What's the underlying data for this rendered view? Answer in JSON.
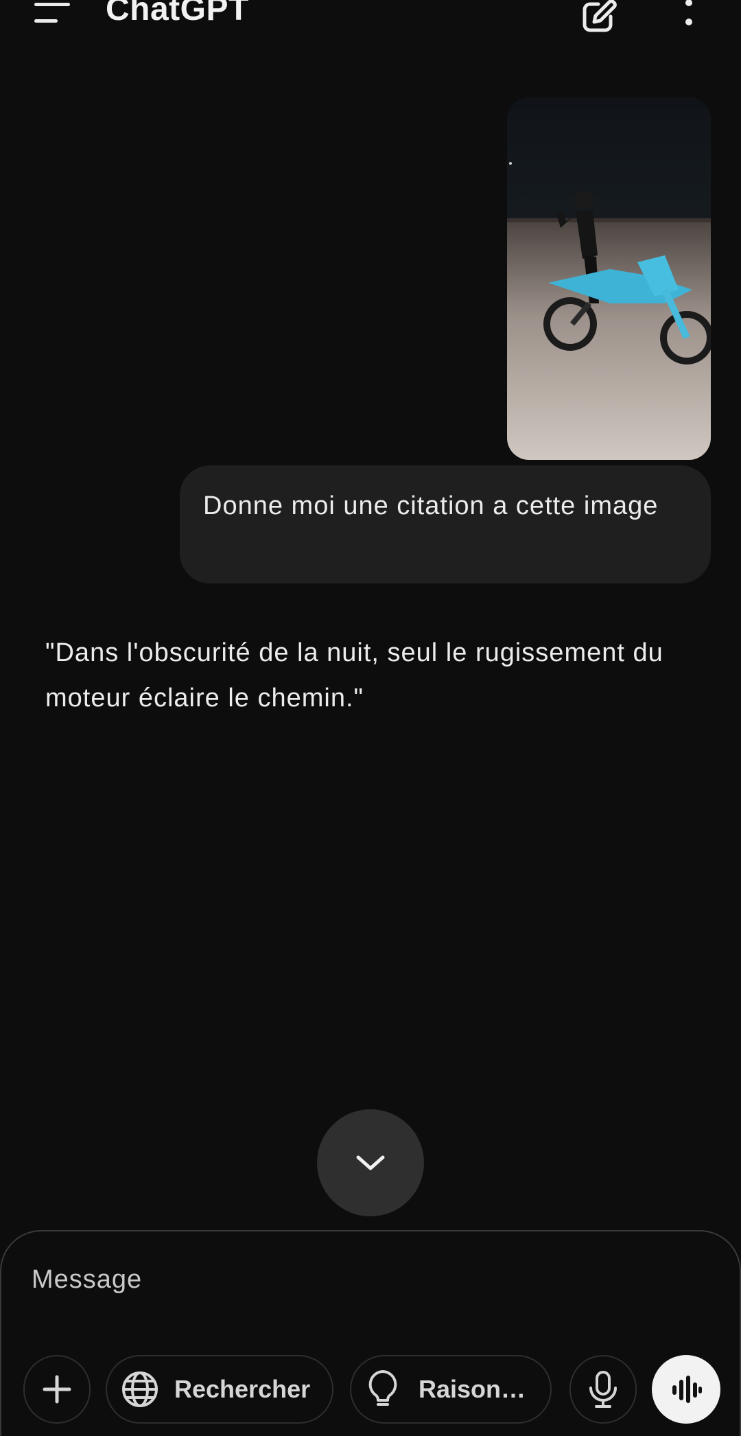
{
  "header": {
    "title": "ChatGPT",
    "menu_icon": "menu-icon",
    "new_chat_icon": "edit-icon",
    "more_icon": "more-vertical-icon"
  },
  "conversation": {
    "user_image_alt": "motorcycle-photo",
    "user_message": "Donne moi une citation a cette image",
    "assistant_message": "\"Dans l'obscurité de la nuit, seul le rugissement du moteur éclaire le chemin.\""
  },
  "composer": {
    "placeholder": "Message",
    "search_label": "Rechercher",
    "reason_label": "Raison…",
    "icons": {
      "plus": "plus-icon",
      "search": "globe-icon",
      "reason": "lightbulb-icon",
      "mic": "microphone-icon",
      "voice": "voice-wave-icon"
    }
  },
  "colors": {
    "background": "#0d0d0e",
    "bubble": "#1f1f20",
    "text": "#ececec",
    "scroll_button": "#2f2f30",
    "voice_button": "#f2f2f2"
  }
}
